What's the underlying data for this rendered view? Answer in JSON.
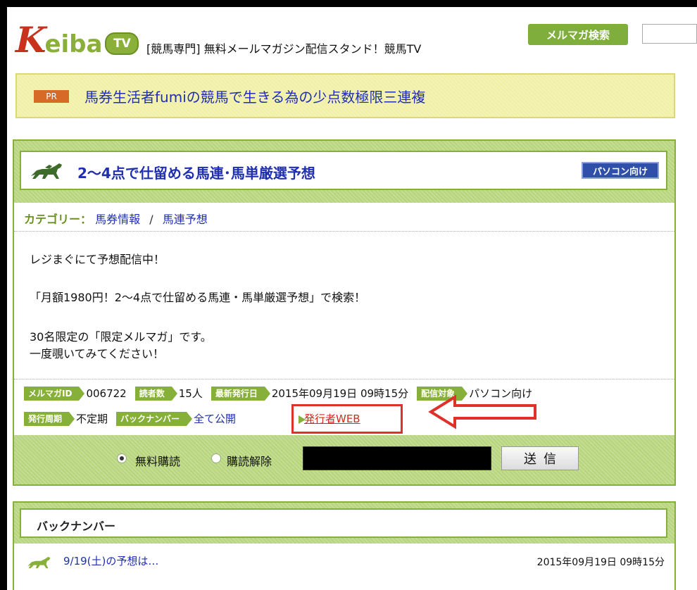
{
  "header": {
    "logo_k": "K",
    "logo_rest": "eiba",
    "logo_tv": "TV",
    "tagline": "[競馬専門] 無料メールマガジン配信スタンド！競馬TV",
    "search_button": "メルマガ検索"
  },
  "pr": {
    "badge": "PR",
    "link": "馬券生活者fumiの競馬で生きる為の少点数極限三連複"
  },
  "magazine": {
    "title": "2〜4点で仕留める馬連･馬単厳選予想",
    "target_badge": "パソコン向け",
    "category_label": "カテゴリー：",
    "category_1": "馬券情報",
    "category_sep": "/",
    "category_2": "馬連予想",
    "desc_1": "レジまぐにて予想配信中！",
    "desc_2": "「月額1980円！2〜4点で仕留める馬連・馬単厳選予想」で検索！",
    "desc_3": "30名限定の「限定メルマガ」です。",
    "desc_4": "一度覗いてみてください！",
    "info": {
      "id_label": "メルマガID",
      "id_value": "006722",
      "readers_label": "読者数",
      "readers_value": "15人",
      "latest_label": "最新発行日",
      "latest_value": "2015年09月19日 09時15分",
      "target_label": "配信対象",
      "target_value": "パソコン向け",
      "cycle_label": "発行周期",
      "cycle_value": "不定期",
      "backnumber_label": "バックナンバー",
      "backnumber_value": "全て公開",
      "publisher_web": "発行者WEB"
    },
    "subscribe": {
      "option_subscribe": "無料購読",
      "option_unsubscribe": "購読解除",
      "send_button": "送信"
    }
  },
  "backnumbers": {
    "title": "バックナンバー",
    "items": [
      {
        "title": "9/19(土)の予想は…",
        "date": "2015年09月19日 09時15分"
      }
    ]
  },
  "colors": {
    "accent_green": "#86b039",
    "link_blue": "#1f2fb0",
    "highlight_red": "#e0302a"
  }
}
